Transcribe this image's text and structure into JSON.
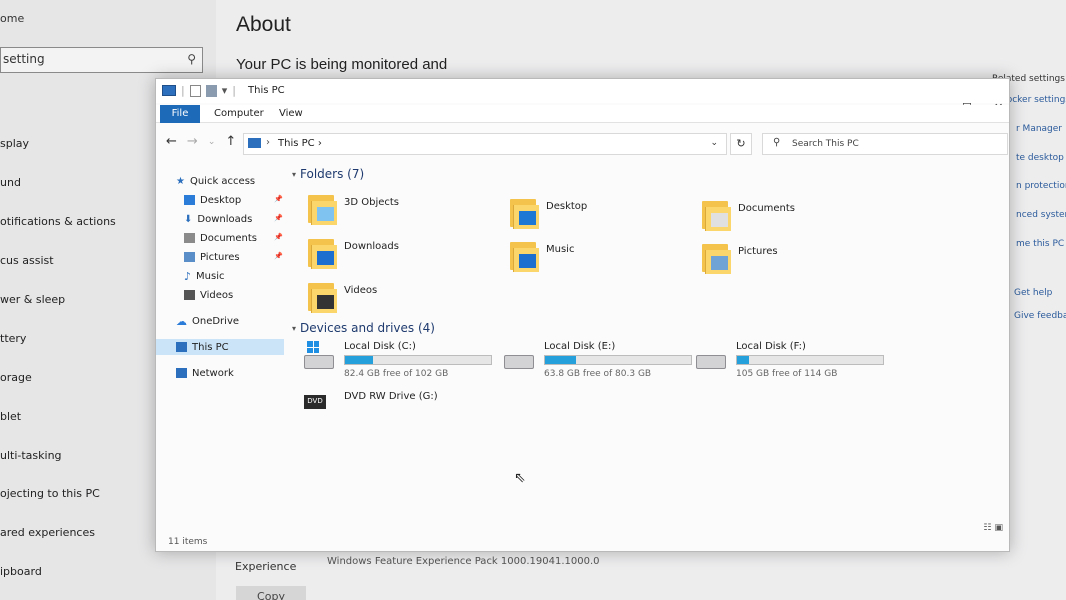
{
  "settings": {
    "home_label": "ome",
    "search_placeholder": "setting",
    "nav_items": [
      "splay",
      "und",
      "otifications & actions",
      "cus assist",
      "wer & sleep",
      "ttery",
      "orage",
      "blet",
      "ulti-tasking",
      "ojecting to this PC",
      "ared experiences",
      "ipboard"
    ],
    "page_title": "About",
    "monitored_text": "Your PC is being monitored and",
    "right_links": [
      "Related settings",
      "Bitlocker settings",
      "r Manager",
      "te desktop",
      "n protection",
      "nced system",
      "me this PC (a",
      "Get help",
      "Give feedbac"
    ],
    "experience_label": "Experience",
    "experience_value": "Windows Feature Experience Pack 1000.19041.1000.0",
    "copy_label": "Copy"
  },
  "explorer": {
    "window_title": "This PC",
    "ribbon_tabs": [
      "File",
      "Computer",
      "View"
    ],
    "window_controls": {
      "minimize": "—",
      "maximize": "☐",
      "close": "✕"
    },
    "address": {
      "crumb": "This PC",
      "separator": "›"
    },
    "search_placeholder": "Search This PC",
    "nav_pane": [
      {
        "label": "Quick access",
        "icon": "star-icon",
        "color": "#2b6fbd"
      },
      {
        "label": "Desktop",
        "icon": "desktop-folder-icon",
        "color": "#2b7bd8",
        "pinned": true
      },
      {
        "label": "Downloads",
        "icon": "download-icon",
        "color": "#2b6fbd",
        "pinned": true
      },
      {
        "label": "Documents",
        "icon": "document-icon",
        "color": "#8a8a8a",
        "pinned": true
      },
      {
        "label": "Pictures",
        "icon": "picture-icon",
        "color": "#5a8ec9",
        "pinned": true
      },
      {
        "label": "Music",
        "icon": "music-icon",
        "color": "#2b6fbd"
      },
      {
        "label": "Videos",
        "icon": "video-icon",
        "color": "#555555"
      },
      {
        "label": "OneDrive",
        "icon": "cloud-icon",
        "color": "#2b7bd8"
      },
      {
        "label": "This PC",
        "icon": "computer-icon",
        "color": "#2b6fbd",
        "selected": true
      },
      {
        "label": "Network",
        "icon": "network-icon",
        "color": "#2b6fbd"
      }
    ],
    "folders_header": "Folders (7)",
    "folders": [
      {
        "label": "3D Objects",
        "badge": "3d-objects-icon",
        "badge_color": "#7fc4f0"
      },
      {
        "label": "Desktop",
        "badge": "desktop-icon",
        "badge_color": "#1c78d4"
      },
      {
        "label": "Documents",
        "badge": "document-icon",
        "badge_color": "#e0e0e0"
      },
      {
        "label": "Downloads",
        "badge": "download-arrow-icon",
        "badge_color": "#1c6fcf"
      },
      {
        "label": "Music",
        "badge": "music-note-icon",
        "badge_color": "#1c6fcf"
      },
      {
        "label": "Pictures",
        "badge": "landscape-icon",
        "badge_color": "#6fa3d6"
      },
      {
        "label": "Videos",
        "badge": "film-icon",
        "badge_color": "#333333"
      }
    ],
    "drives_header": "Devices and drives (4)",
    "drives": [
      {
        "name": "Local Disk (C:)",
        "free_text": "82.4 GB free of 102 GB",
        "used_fraction": 0.19,
        "system": true
      },
      {
        "name": "Local Disk (E:)",
        "free_text": "63.8 GB free of 80.3 GB",
        "used_fraction": 0.21
      },
      {
        "name": "Local Disk (F:)",
        "free_text": "105 GB free of 114 GB",
        "used_fraction": 0.08
      }
    ],
    "dvd": {
      "name": "DVD RW Drive (G:)",
      "badge": "DVD"
    },
    "status_text": "11 items"
  }
}
